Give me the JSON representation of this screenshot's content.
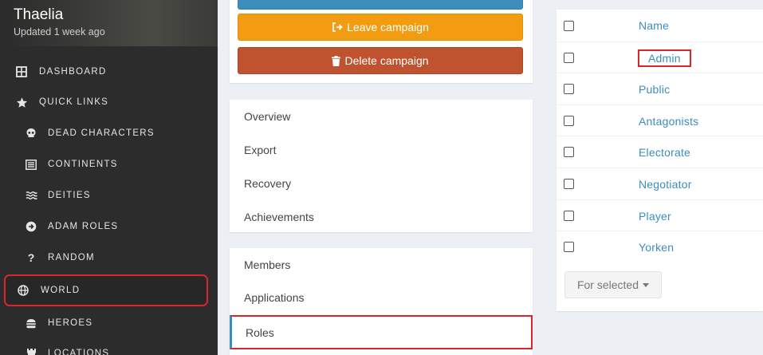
{
  "campaign": {
    "name": "Thaelia",
    "updated": "Updated 1 week ago"
  },
  "sidebar": {
    "items": [
      {
        "label": "Dashboard",
        "icon": "grid-icon"
      },
      {
        "label": "Quick Links",
        "icon": "star-icon"
      },
      {
        "label": "Dead Characters",
        "icon": "skull-icon"
      },
      {
        "label": "Continents",
        "icon": "list-icon"
      },
      {
        "label": "Deities",
        "icon": "water-icon"
      },
      {
        "label": "Adam Roles",
        "icon": "arrow-circle-right-icon"
      },
      {
        "label": "Random",
        "icon": "question-icon"
      },
      {
        "label": "World",
        "icon": "globe-icon"
      },
      {
        "label": "Heroes",
        "icon": "burger-icon"
      },
      {
        "label": "Locations",
        "icon": "castle-icon"
      }
    ]
  },
  "actions": {
    "leave_label": "Leave campaign",
    "delete_label": "Delete campaign"
  },
  "menu1": [
    "Overview",
    "Export",
    "Recovery",
    "Achievements"
  ],
  "menu2": [
    "Members",
    "Applications",
    "Roles"
  ],
  "roles_table": {
    "header": "Name",
    "rows": [
      "Admin",
      "Public",
      "Antagonists",
      "Electorate",
      "Negotiator",
      "Player",
      "Yorken"
    ],
    "bulk_label": "For selected"
  },
  "colors": {
    "primary": "#3c8dbc",
    "warning": "#f39c12",
    "danger": "#c0532f",
    "highlight": "#d9262b",
    "sidebar_bg": "#2c2c2c"
  }
}
